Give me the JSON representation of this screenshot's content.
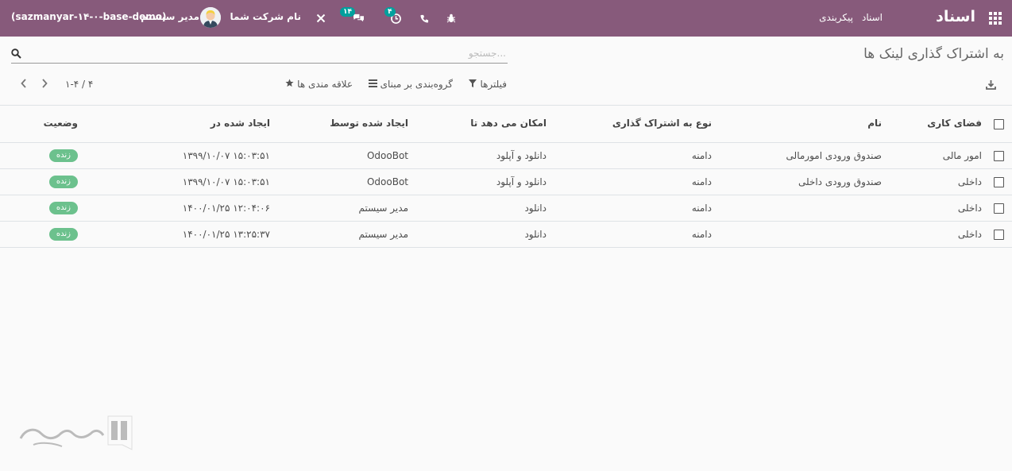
{
  "navbar": {
    "brand": "اسناد",
    "menu": [
      "اسناد",
      "پیکربندی"
    ],
    "icons": [
      "apps-icon",
      "bug-icon",
      "phone-icon",
      "clock-icon",
      "chat-icon",
      "tools-icon"
    ],
    "activity_count": "۴",
    "messages_count": "۱۴",
    "company": "نام شرکت شما",
    "user": "مدیر سیستم",
    "database": "(sazmanyar-۱۴-۰-base-demo)",
    "color": "#875a7b"
  },
  "control_panel": {
    "title": "به اشتراک گذاری لینک ها",
    "search_placeholder": "جستجو...",
    "filters_label": "فیلترها",
    "group_by_label": "گروه‌بندی بر مبنای",
    "favorites_label": "علاقه مندی ها",
    "pager": "۱-۴ / ۴"
  },
  "table": {
    "columns": [
      "فضای کاری",
      "نام",
      "نوع به اشتراک گذاری",
      "امکان می دهد تا",
      "ایجاد شده توسط",
      "ایجاد شده در",
      "وضعیت"
    ],
    "rows": [
      {
        "workspace": "امور مالی",
        "name": "صندوق ورودی امورمالی",
        "type": "دامنه",
        "allows": "دانلود و آپلود",
        "created_by": "OdooBot",
        "created_on": "۱۳۹۹/۱۰/۰۷ ۱۵:۰۳:۵۱",
        "status": "زنده"
      },
      {
        "workspace": "داخلی",
        "name": "صندوق ورودی داخلی",
        "type": "دامنه",
        "allows": "دانلود و آپلود",
        "created_by": "OdooBot",
        "created_on": "۱۳۹۹/۱۰/۰۷ ۱۵:۰۳:۵۱",
        "status": "زنده"
      },
      {
        "workspace": "داخلی",
        "name": "",
        "type": "دامنه",
        "allows": "دانلود",
        "created_by": "مدیر سیستم",
        "created_on": "۱۴۰۰/۰۱/۲۵ ۱۲:۰۴:۰۶",
        "status": "زنده"
      },
      {
        "workspace": "داخلی",
        "name": "",
        "type": "دامنه",
        "allows": "دانلود",
        "created_by": "مدیر سیستم",
        "created_on": "۱۴۰۰/۰۱/۲۵ ۱۳:۲۵:۳۷",
        "status": "زنده"
      }
    ],
    "status_color": "#6cc18d"
  }
}
